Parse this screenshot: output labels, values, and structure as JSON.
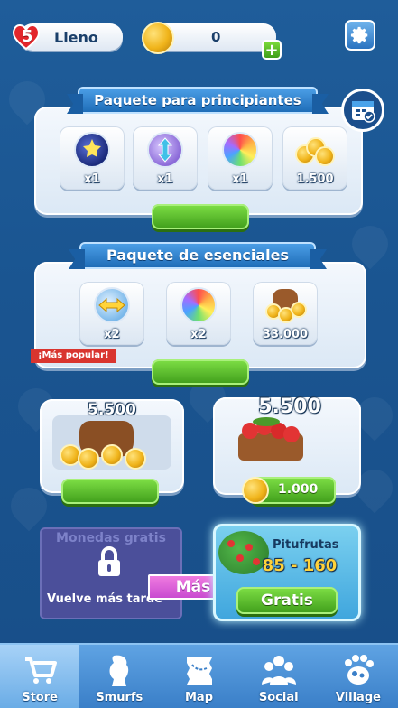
{
  "header": {
    "lives_count": "5",
    "lives_status": "Lleno",
    "coins": "0"
  },
  "starter_pack": {
    "title": "Paquete para principiantes",
    "items": [
      {
        "icon": "star-orb-icon",
        "qty": "x1"
      },
      {
        "icon": "arrows-vertical-orb-icon",
        "qty": "x1"
      },
      {
        "icon": "rainbow-orb-icon",
        "qty": "x1"
      },
      {
        "icon": "coins-stack-icon",
        "qty": "1.500"
      }
    ]
  },
  "essentials_pack": {
    "title": "Paquete de esenciales",
    "badge": "¡Más popular!",
    "items": [
      {
        "icon": "arrows-horizontal-orb-icon",
        "qty": "x2"
      },
      {
        "icon": "rainbow-orb-icon",
        "qty": "x2"
      },
      {
        "icon": "coin-sack-icon",
        "qty": "33.000"
      }
    ]
  },
  "offers": {
    "coins_offer": {
      "amount": "5.500"
    },
    "berries_offer": {
      "amount": "5.500",
      "price": "1.000"
    }
  },
  "free_coins": {
    "title": "Monedas gratis",
    "message": "Vuelve más tarde",
    "more_label": "Más"
  },
  "smurfberries": {
    "title": "Pitufrutas",
    "range": "85 - 160",
    "button": "Gratis"
  },
  "nav": {
    "items": [
      {
        "label": "Store",
        "icon": "cart-icon",
        "active": true
      },
      {
        "label": "Smurfs",
        "icon": "smurf-icon",
        "active": false
      },
      {
        "label": "Map",
        "icon": "map-icon",
        "active": false
      },
      {
        "label": "Social",
        "icon": "people-icon",
        "active": false
      },
      {
        "label": "Village",
        "icon": "paw-icon",
        "active": false
      }
    ]
  },
  "colors": {
    "background": "#1d5a97",
    "accent_green": "#4fb82a",
    "ribbon_blue": "#2f82cf",
    "badge_red": "#d9352f"
  }
}
